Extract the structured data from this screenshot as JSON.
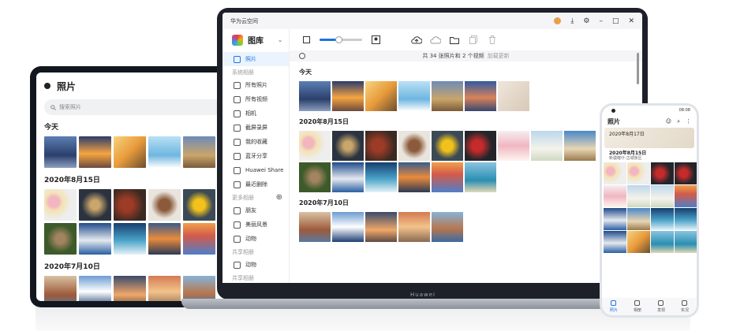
{
  "tablet": {
    "title": "照片",
    "search_placeholder": "搜索照片",
    "sections": [
      {
        "label": "今天",
        "photos": [
          "c1",
          "c2",
          "c3",
          "c4",
          "c5"
        ]
      },
      {
        "label": "2020年8月15日",
        "photos": [
          "c8",
          "c9",
          "c10",
          "c11",
          "c12",
          "c17",
          "c18",
          "c19",
          "c20",
          "c21"
        ]
      },
      {
        "label": "2020年7月10日",
        "photos": [
          "c23",
          "c24",
          "c25",
          "c26",
          "c27"
        ]
      }
    ]
  },
  "laptop": {
    "window_title": "华为云空间",
    "brand_label": "Huawei",
    "app_name": "图库",
    "status": {
      "count_text": "共 34 张照片和 2 个视频",
      "update_text": "加载更新"
    },
    "sidebar": {
      "items": [
        {
          "label": "照片",
          "active": true,
          "name": "photos"
        },
        {
          "group": "系统相册"
        },
        {
          "label": "所有照片",
          "name": "all-photos"
        },
        {
          "label": "所有视频",
          "name": "all-videos"
        },
        {
          "label": "相机",
          "name": "camera"
        },
        {
          "label": "截屏录屏",
          "name": "screenshots"
        },
        {
          "label": "我的收藏",
          "name": "favorites"
        },
        {
          "label": "蓝牙分享",
          "name": "bluetooth-share"
        },
        {
          "label": "Huawei Share",
          "name": "huawei-share"
        },
        {
          "label": "最近删除",
          "name": "recently-deleted"
        },
        {
          "group": "更多相册",
          "plus": true
        },
        {
          "label": "朋友",
          "name": "friends"
        },
        {
          "label": "美丽风景",
          "name": "scenery"
        },
        {
          "label": "动物",
          "name": "animals"
        },
        {
          "group": "共享相册"
        },
        {
          "label": "动物",
          "name": "shared-animals"
        },
        {
          "group": "共享相册"
        }
      ]
    },
    "sections": [
      {
        "label": "今天",
        "photos": [
          "c1",
          "c2",
          "c3",
          "c4",
          "c5",
          "c6",
          "c7"
        ]
      },
      {
        "label": "2020年8月15日",
        "photos": [
          "c8",
          "c9",
          "c10",
          "c11",
          "c12",
          "c13",
          "c14",
          "c15",
          "c16",
          "c17",
          "c18",
          "c19",
          "c20",
          "c21",
          "c22"
        ]
      },
      {
        "label": "2020年7月10日",
        "photos": [
          "c23",
          "c24",
          "c25",
          "c26",
          "c27"
        ]
      }
    ],
    "zoom_level": 0.45
  },
  "phone": {
    "status_time": "08:08",
    "title": "照片",
    "card": {
      "date": "2020年8月17日",
      "date2": "2020年8月15日",
      "place": "新疆喀什·古城景区"
    },
    "photos": [
      "c8",
      "c8",
      "c13",
      "c13",
      "c14",
      "c15",
      "c15",
      "c21",
      "c18",
      "c16",
      "c19",
      "c19",
      "c18",
      "c3",
      "c22",
      "c22"
    ],
    "tabs": [
      {
        "label": "照片",
        "on": true
      },
      {
        "label": "相册"
      },
      {
        "label": "发现"
      },
      {
        "label": "实况"
      }
    ]
  }
}
